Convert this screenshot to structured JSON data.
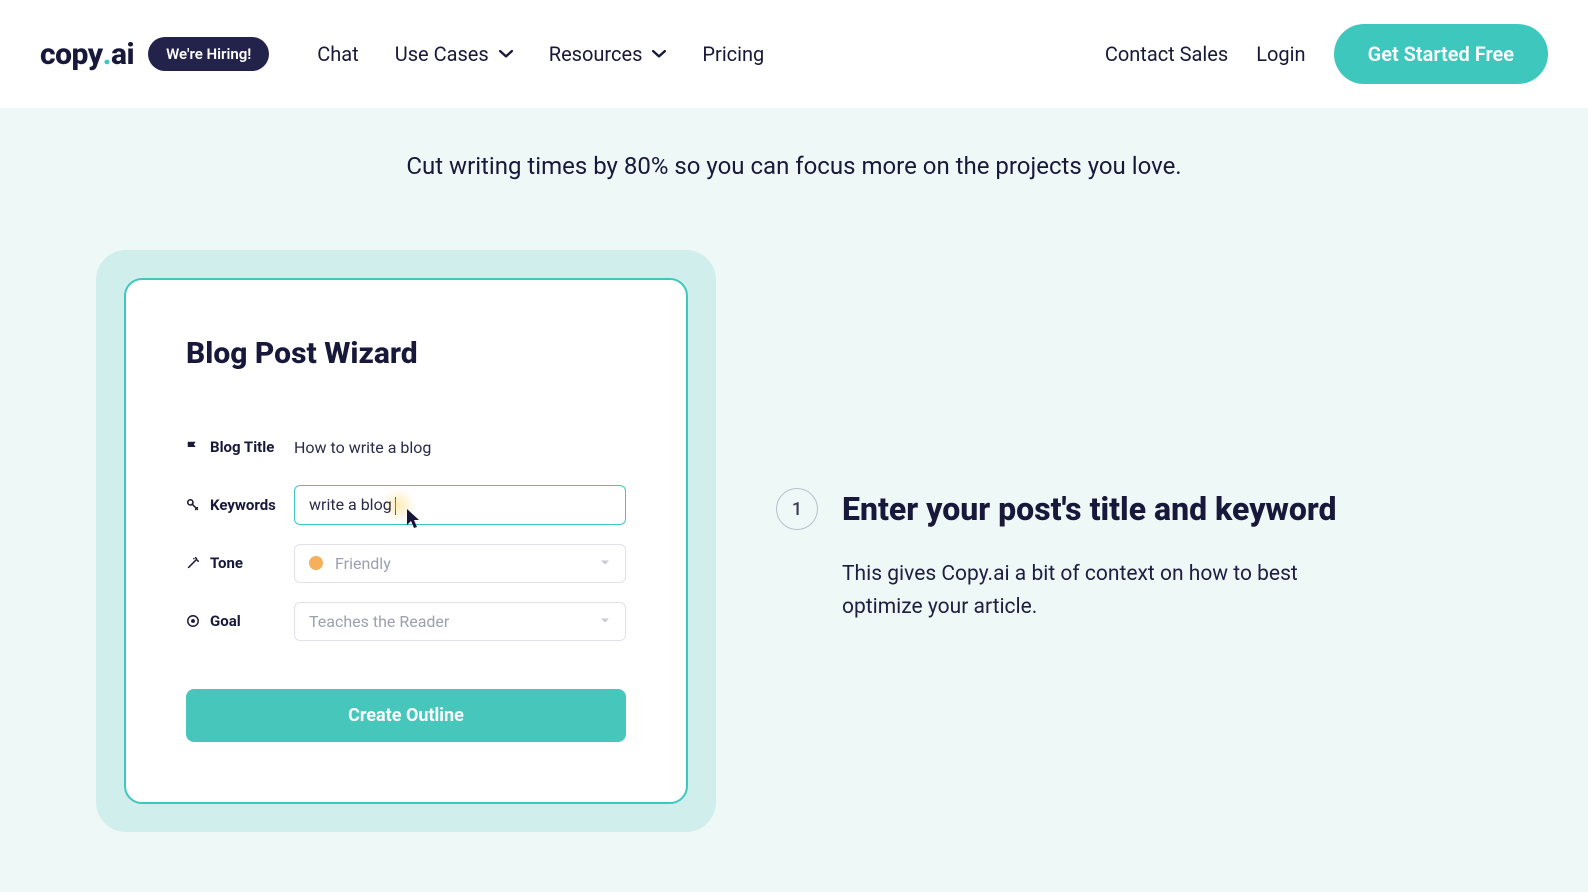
{
  "header": {
    "logo_text_pre": "copy",
    "logo_text_post": "ai",
    "hiring": "We're Hiring!",
    "nav": {
      "chat": "Chat",
      "use_cases": "Use Cases",
      "resources": "Resources",
      "pricing": "Pricing"
    },
    "right": {
      "contact": "Contact Sales",
      "login": "Login",
      "cta": "Get Started Free"
    }
  },
  "hero": {
    "tagline": "Cut writing times by 80% so you can focus more on the projects you love."
  },
  "wizard": {
    "title": "Blog Post Wizard",
    "fields": {
      "blog_title_label": "Blog Title",
      "blog_title_value": "How to write a blog",
      "keywords_label": "Keywords",
      "keywords_value": "write a blog",
      "tone_label": "Tone",
      "tone_placeholder": "Friendly",
      "goal_label": "Goal",
      "goal_placeholder": "Teaches the Reader"
    },
    "create_btn": "Create Outline"
  },
  "step": {
    "number": "1",
    "title": "Enter your post's title and keyword",
    "desc": "This gives Copy.ai a bit of context on how to best optimize your article."
  }
}
